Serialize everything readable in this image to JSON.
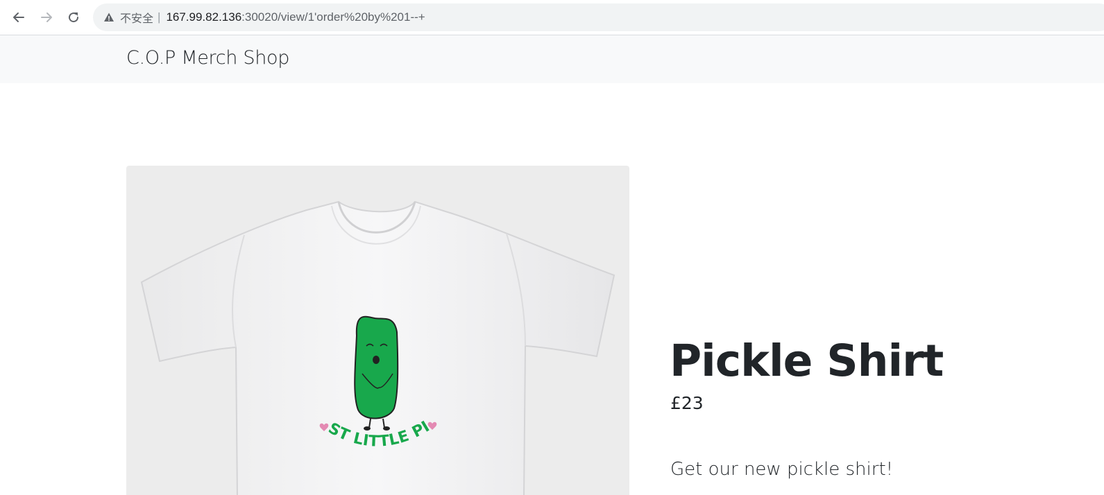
{
  "browser": {
    "back_icon": "arrow-left-icon",
    "forward_icon": "arrow-right-icon",
    "reload_icon": "reload-icon",
    "security_icon": "warning-triangle-icon",
    "security_label": "不安全",
    "url_host": "167.99.82.136",
    "url_rest": ":30020/view/1'order%20by%201--+"
  },
  "site": {
    "brand": "C.O.P Merch Shop"
  },
  "product": {
    "image_alt": "Pickle shirt",
    "shirt_print_text": "CUTEST LITTLE PICKLE",
    "title": "Pickle Shirt",
    "price": "£23",
    "description": "Get our new pickle shirt!"
  },
  "colors": {
    "navbar_bg": "#f8f9fa",
    "pickle_green": "#18a84c",
    "heart_pink": "#e48ab3",
    "text_dark": "#212529"
  }
}
